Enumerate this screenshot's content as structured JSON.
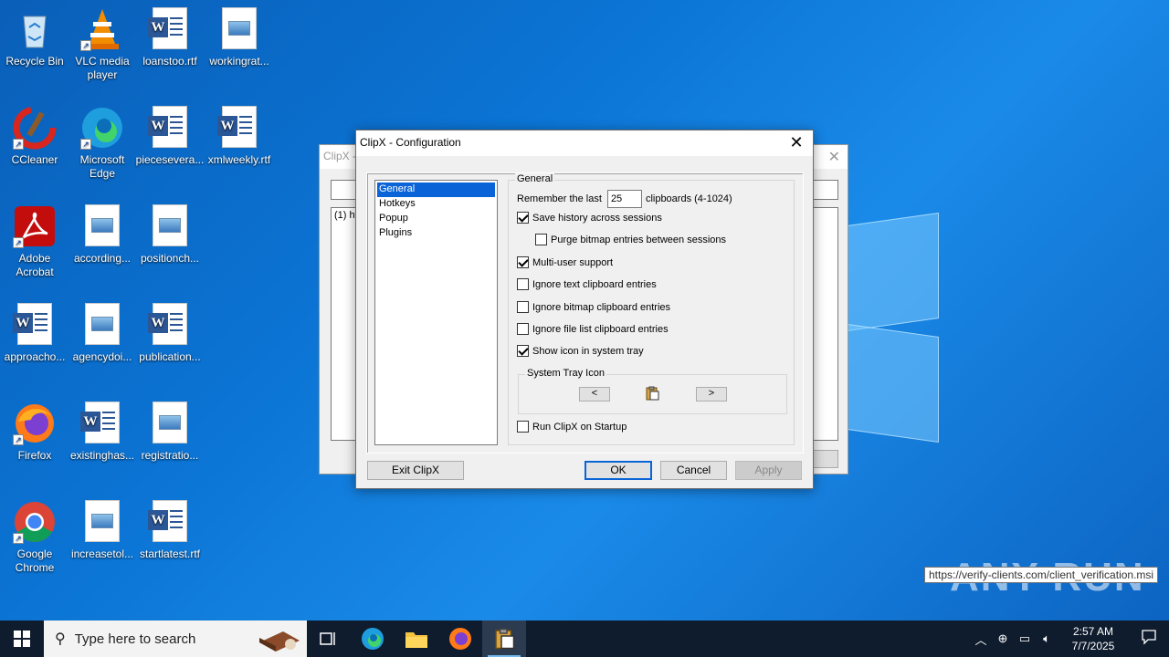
{
  "desktop": {
    "icons": [
      {
        "label": "Recycle Bin"
      },
      {
        "label": "VLC media player"
      },
      {
        "label": "loanstoo.rtf"
      },
      {
        "label": "workingrat..."
      },
      {
        "label": "CCleaner"
      },
      {
        "label": "Microsoft Edge"
      },
      {
        "label": "piecesevera..."
      },
      {
        "label": "xmlweekly.rtf"
      },
      {
        "label": "Adobe Acrobat"
      },
      {
        "label": "according..."
      },
      {
        "label": "positionch..."
      },
      {
        "label": "approacho..."
      },
      {
        "label": "agencydoi..."
      },
      {
        "label": "publication..."
      },
      {
        "label": "Firefox"
      },
      {
        "label": "existinghas..."
      },
      {
        "label": "registratio..."
      },
      {
        "label": "Google Chrome"
      },
      {
        "label": "increasetol..."
      },
      {
        "label": "startlatest.rtf"
      }
    ]
  },
  "bg_window": {
    "title": "ClipX -",
    "list_first": "(1) htt"
  },
  "dialog": {
    "title": "ClipX - Configuration",
    "tree": [
      "General",
      "Hotkeys",
      "Popup",
      "Plugins"
    ],
    "group_title": "General",
    "remember_prefix": "Remember the last",
    "remember_value": "25",
    "remember_suffix": "clipboards (4-1024)",
    "options": {
      "save_history": {
        "label": "Save history across sessions",
        "checked": true
      },
      "purge_bitmap": {
        "label": "Purge bitmap entries between sessions",
        "checked": false
      },
      "multi_user": {
        "label": "Multi-user support",
        "checked": true
      },
      "ignore_text": {
        "label": "Ignore text clipboard entries",
        "checked": false
      },
      "ignore_bitmap": {
        "label": "Ignore bitmap clipboard entries",
        "checked": false
      },
      "ignore_filelist": {
        "label": "Ignore file list clipboard entries",
        "checked": false
      },
      "show_tray": {
        "label": "Show icon in system tray",
        "checked": true
      },
      "run_startup": {
        "label": "Run ClipX on Startup",
        "checked": false
      }
    },
    "tray_group_title": "System Tray Icon",
    "prev": "<",
    "next": ">",
    "buttons": {
      "exit": "Exit ClipX",
      "ok": "OK",
      "cancel": "Cancel",
      "apply": "Apply"
    }
  },
  "tooltip": "https://verify-clients.com/client_verification.msi",
  "watermark": "ANY RUN",
  "taskbar": {
    "search_placeholder": "Type here to search",
    "time": "2:57 AM",
    "date": "7/7/2025"
  }
}
